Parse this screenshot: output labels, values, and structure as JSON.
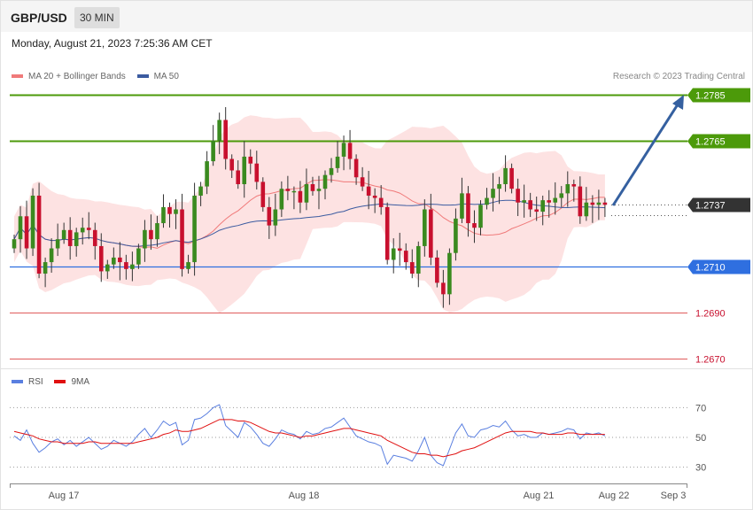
{
  "header": {
    "symbol": "GBP/USD",
    "timeframe": "30 MIN"
  },
  "datetime": "Monday, August 21, 2023 7:25:36 AM CET",
  "legend": {
    "bb_label": "MA 20 + Bollinger Bands",
    "ma50_label": "MA 50",
    "copyright": "Research © 2023 Trading Central"
  },
  "rsi_legend": {
    "rsi_label": "RSI",
    "ma_label": "9MA"
  },
  "colors": {
    "up": "#3a8a1f",
    "down": "#c8102e",
    "bb_fill": "#fde2e2",
    "bb_line": "#f07a7a",
    "ma50": "#3b5ba0",
    "green_level": "#4c9a0a",
    "blue_level": "#2f6fe0",
    "red_level": "#e05c5c",
    "arrow": "#3560a0",
    "current": "#333333",
    "rsi": "#5a7fe0",
    "rsi_ma": "#e01010"
  },
  "chart_data": {
    "type": "candlestick",
    "x_labels": [
      "Aug 17",
      "Aug 18",
      "Aug 21",
      "Aug 22",
      "Sep 3"
    ],
    "y_range": [
      1.267,
      1.2795
    ],
    "levels": [
      {
        "value": 1.2785,
        "label": "1.2785",
        "kind": "resistance"
      },
      {
        "value": 1.2765,
        "label": "1.2765",
        "kind": "resistance"
      },
      {
        "value": 1.2737,
        "label": "1.2737",
        "kind": "current"
      },
      {
        "value": 1.271,
        "label": "1.2710",
        "kind": "pivot"
      },
      {
        "value": 1.269,
        "label": "1.2690",
        "kind": "support"
      },
      {
        "value": 1.267,
        "label": "1.2670",
        "kind": "support"
      }
    ],
    "closes": [
      1.2722,
      1.2732,
      1.2718,
      1.2741,
      1.2707,
      1.2712,
      1.2718,
      1.2722,
      1.2726,
      1.2719,
      1.2725,
      1.2727,
      1.2726,
      1.2719,
      1.2708,
      1.2711,
      1.2714,
      1.2712,
      1.2709,
      1.2711,
      1.2718,
      1.2726,
      1.2722,
      1.2729,
      1.2736,
      1.2733,
      1.2735,
      1.2709,
      1.2712,
      1.2741,
      1.2745,
      1.2756,
      1.2765,
      1.2774,
      1.2757,
      1.2752,
      1.2746,
      1.2758,
      1.2755,
      1.2747,
      1.2736,
      1.2728,
      1.2735,
      1.2744,
      1.2743,
      1.2743,
      1.2738,
      1.2746,
      1.2743,
      1.2744,
      1.275,
      1.2753,
      1.2758,
      1.2764,
      1.2757,
      1.2749,
      1.2745,
      1.2741,
      1.274,
      1.2736,
      1.2713,
      1.2718,
      1.2717,
      1.2712,
      1.2707,
      1.2719,
      1.2735,
      1.2714,
      1.2703,
      1.2698,
      1.2716,
      1.2731,
      1.2742,
      1.2729,
      1.2727,
      1.2737,
      1.274,
      1.2744,
      1.2746,
      1.2753,
      1.2744,
      1.2738,
      1.2739,
      1.2735,
      1.2734,
      1.2739,
      1.2738,
      1.274,
      1.2742,
      1.2746,
      1.2745,
      1.2732,
      1.2738,
      1.2737,
      1.2738,
      1.2737
    ],
    "rsi": {
      "y_ticks": [
        30,
        50,
        70
      ],
      "rsi_values": [
        51,
        48,
        55,
        46,
        40,
        43,
        47,
        49,
        45,
        48,
        44,
        47,
        50,
        46,
        42,
        44,
        48,
        46,
        44,
        47,
        52,
        56,
        50,
        55,
        61,
        58,
        60,
        45,
        48,
        62,
        63,
        66,
        70,
        72,
        58,
        54,
        50,
        60,
        57,
        52,
        46,
        44,
        49,
        55,
        53,
        52,
        49,
        54,
        52,
        53,
        56,
        57,
        60,
        63,
        57,
        51,
        49,
        47,
        46,
        44,
        32,
        38,
        37,
        36,
        34,
        41,
        50,
        38,
        33,
        31,
        42,
        53,
        59,
        51,
        50,
        55,
        56,
        58,
        57,
        61,
        55,
        51,
        52,
        50,
        50,
        53,
        52,
        53,
        54,
        56,
        55,
        49,
        53,
        52,
        53,
        51
      ],
      "ma_values": [
        54,
        53,
        52,
        51,
        49,
        48,
        47,
        47,
        46,
        46,
        46,
        46,
        47,
        47,
        46,
        46,
        46,
        46,
        46,
        46,
        47,
        48,
        49,
        50,
        52,
        53,
        55,
        54,
        54,
        55,
        56,
        58,
        60,
        62,
        62,
        62,
        61,
        61,
        60,
        58,
        56,
        54,
        53,
        53,
        52,
        51,
        50,
        51,
        51,
        52,
        53,
        54,
        55,
        56,
        56,
        55,
        54,
        53,
        52,
        51,
        48,
        46,
        44,
        42,
        40,
        39,
        39,
        38,
        38,
        37,
        38,
        39,
        41,
        42,
        43,
        45,
        47,
        49,
        51,
        53,
        54,
        54,
        54,
        54,
        53,
        53,
        52,
        52,
        52,
        53,
        53,
        52,
        52,
        52,
        52,
        52
      ]
    }
  }
}
